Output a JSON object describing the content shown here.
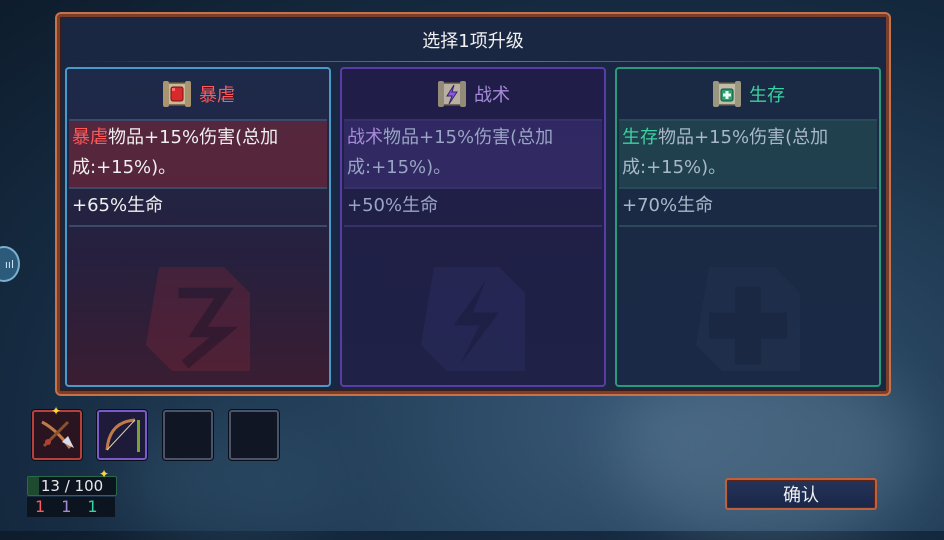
{
  "dialog": {
    "title": "选择1项升级"
  },
  "cards": [
    {
      "name": "暴虐",
      "row1_keyword": "暴虐",
      "row1_rest": "物品+15%伤害(总加成:+15%)。",
      "row2": "+65%生命",
      "icon": "red-scroll-fist-icon",
      "color": "#ff5a5a"
    },
    {
      "name": "战术",
      "row1_keyword": "战术",
      "row1_rest": "物品+15%伤害(总加成:+15%)。",
      "row2": "+50%生命",
      "icon": "purple-scroll-lightning-icon",
      "color": "#a58ad8"
    },
    {
      "name": "生存",
      "row1_keyword": "生存",
      "row1_rest": "物品+15%伤害(总加成:+15%)。",
      "row2": "+70%生命",
      "icon": "green-scroll-cross-icon",
      "color": "#3ad2a0"
    }
  ],
  "inventory": {
    "slots": [
      {
        "icon": "crossbow-item-icon",
        "tier": "red"
      },
      {
        "icon": "bow-item-icon",
        "tier": "purple"
      },
      {
        "icon": "empty-slot",
        "tier": "empty"
      },
      {
        "icon": "empty-slot",
        "tier": "empty"
      }
    ],
    "counter_current": "13",
    "counter_sep": "/",
    "counter_max": "100",
    "counter_fill": 0.13,
    "stats": {
      "red": "1",
      "purple": "1",
      "green": "1"
    }
  },
  "side_badge": "ııl",
  "buttons": {
    "confirm_label": "确认"
  }
}
